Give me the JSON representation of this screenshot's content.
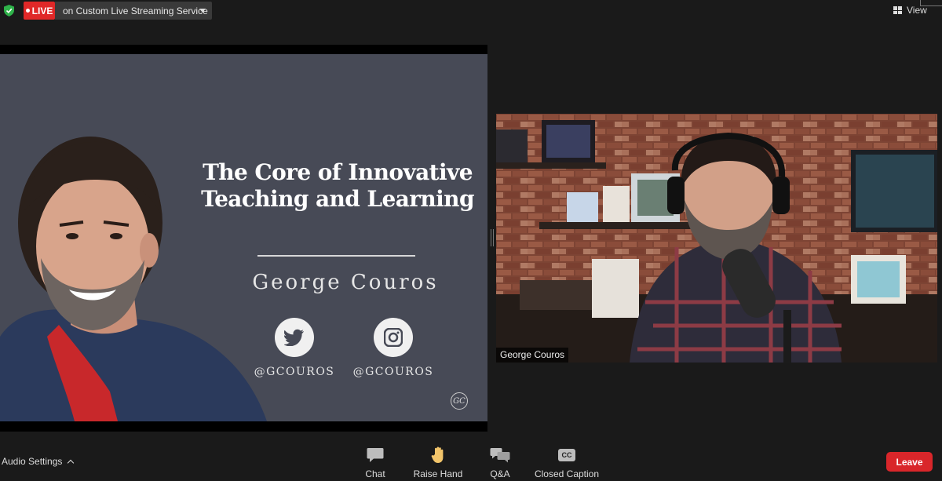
{
  "topbar": {
    "live_label": "LIVE",
    "stream_service": "on Custom Live Streaming Service",
    "view_label": "View"
  },
  "slide": {
    "title_line1": "The Core of Innovative",
    "title_line2": "Teaching and Learning",
    "presenter_name": "George Couros",
    "twitter_handle": "@GCOUROS",
    "instagram_handle": "@GCOUROS",
    "logo_text": "GC",
    "background_color": "#474a56"
  },
  "camera": {
    "participant_name": "George Couros"
  },
  "toolbar": {
    "audio_settings_label": "Audio Settings",
    "chat_label": "Chat",
    "raise_hand_label": "Raise Hand",
    "qa_label": "Q&A",
    "closed_caption_label": "Closed Caption",
    "cc_badge": "CC",
    "leave_label": "Leave"
  },
  "colors": {
    "live_red": "#e02828",
    "leave_red": "#d9262a",
    "shield_green": "#2fb34a"
  }
}
